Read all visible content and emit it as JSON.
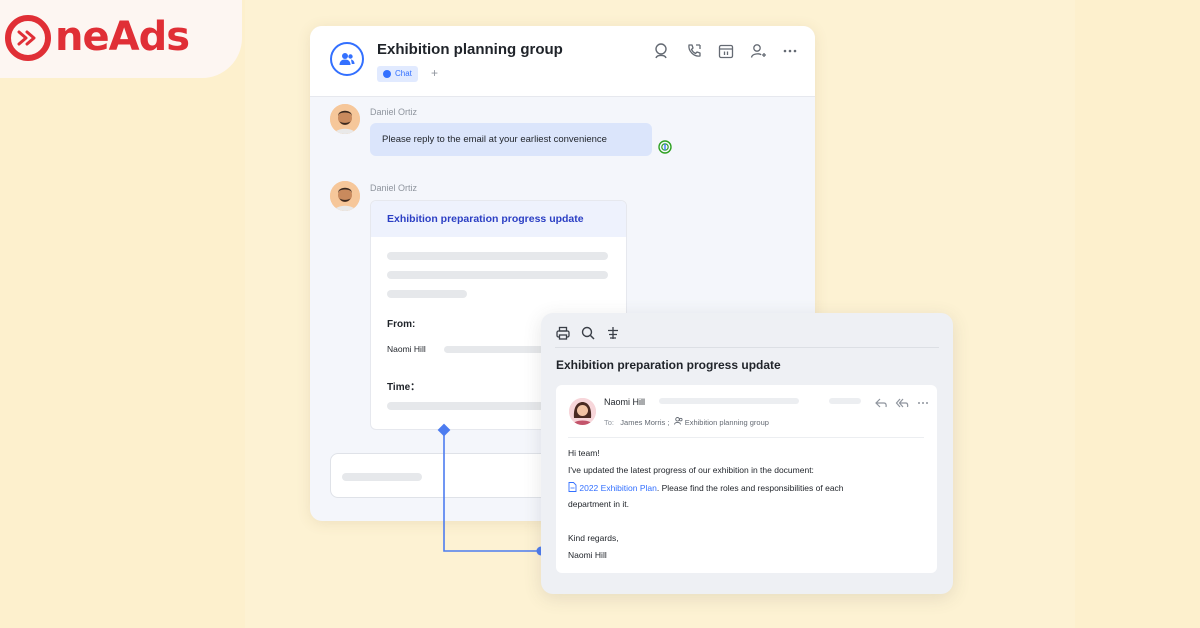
{
  "brand": {
    "logo_text": "neAds",
    "colors": {
      "red": "#e02f36",
      "accent": "#3370ff",
      "background": "#fdf0cd"
    }
  },
  "chat": {
    "title": "Exhibition planning group",
    "tab_label": "Chat",
    "add_tab": "+",
    "header_icons": [
      "search-icon",
      "call-icon",
      "calendar-icon",
      "add-member-icon",
      "more-icon"
    ],
    "messages": [
      {
        "sender": "Daniel Ortiz",
        "text": "Please reply to the email at your earliest convenience"
      },
      {
        "sender": "Daniel Ortiz"
      }
    ],
    "card": {
      "title": "Exhibition preparation progress update",
      "from_label": "From:",
      "from_value": "Naomi Hill",
      "time_label": "Time："
    }
  },
  "email": {
    "toolbar_icons": [
      "print-icon",
      "search-icon",
      "translate-icon"
    ],
    "subject": "Exhibition preparation progress update",
    "from": "Naomi Hill",
    "to_label": "To:",
    "to_recipient": "James Morris ;",
    "to_group": "Exhibition planning group",
    "greeting": "Hi team!",
    "line1": "I've updated the latest progress of our exhibition in the document:",
    "doc_link": "2022 Exhibition Plan",
    "line2_rest": ". Please find the roles and responsibilities of each",
    "line3": "department in it.",
    "closing": "Kind regards,",
    "signature": "Naomi Hill"
  }
}
